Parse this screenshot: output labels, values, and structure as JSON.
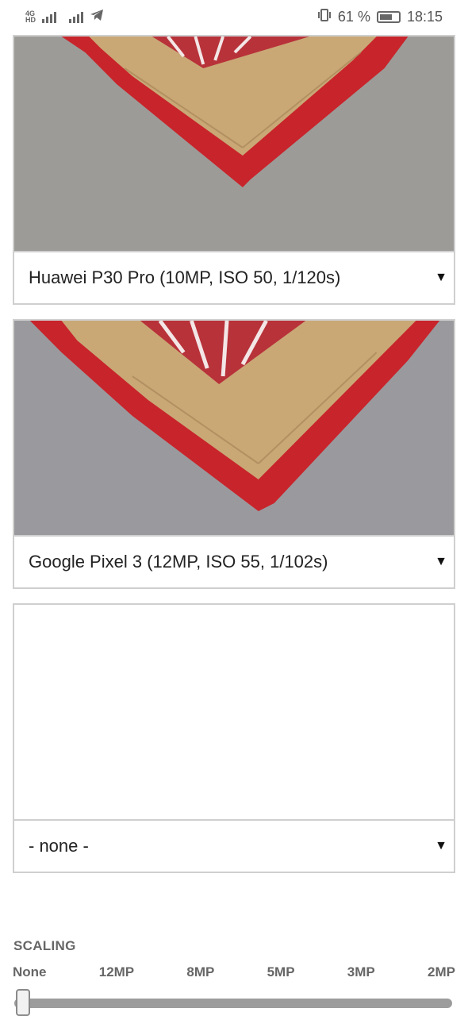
{
  "status_bar": {
    "network_tag_top": "4G",
    "network_tag_bottom": "HD",
    "battery_percent": "61 %",
    "time": "18:15",
    "icons": [
      "signal-icon",
      "signal-icon",
      "telegram-icon",
      "vibrate-icon",
      "battery-icon"
    ]
  },
  "cards": [
    {
      "select_value": "Huawei P30 Pro (10MP, ISO 50, 1/120s)"
    },
    {
      "select_value": "Google Pixel 3 (12MP, ISO 55, 1/102s)"
    },
    {
      "select_value": "- none -"
    }
  ],
  "scaling": {
    "title": "SCALING",
    "labels": [
      "None",
      "12MP",
      "8MP",
      "5MP",
      "3MP",
      "2MP"
    ],
    "selected_index": 0
  },
  "colors": {
    "accent_red": "#c8242b",
    "burlap": "#c9a876",
    "background_gray": "#9a9a9a"
  }
}
